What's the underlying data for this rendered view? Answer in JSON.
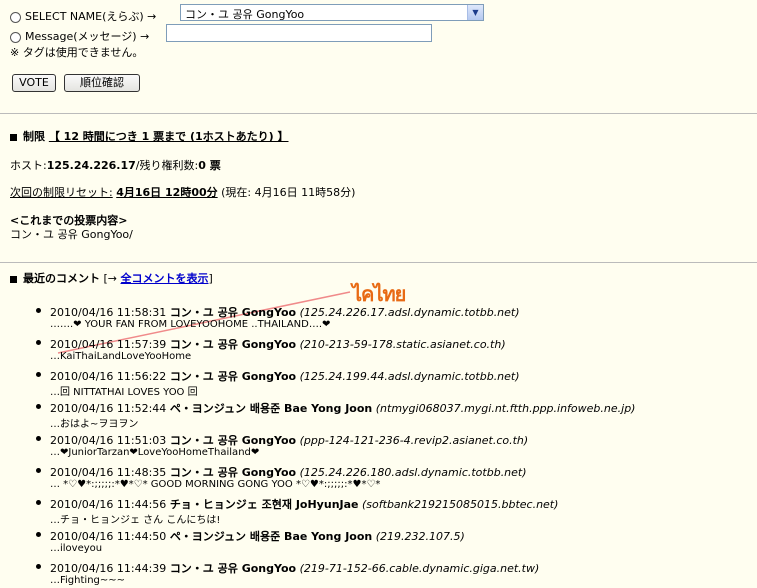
{
  "form": {
    "select_name_label": "SELECT NAME(えらぶ) →",
    "select_value": "コン・ユ 공유 GongYoo",
    "message_label": "Message(メッセージ) →",
    "message_value": "",
    "tag_note": "※ タグは使用できません。",
    "vote_button": "VOTE",
    "rank_button": "順位確認"
  },
  "limits": {
    "heading_prefix": "制限",
    "heading_rule": "【 12 時間につき 1 票まで (1ホストあたり) 】",
    "host_label": "ホスト:",
    "host_value": "125.24.226.17",
    "remaining_label": "/残り権利数:",
    "remaining_value": "0 票",
    "reset_label": "次回の制限リセット:",
    "reset_value": "4月16日 12時00分",
    "current_time": "(現在: 4月16日 11時58分)",
    "history_heading": "<これまでの投票内容>",
    "history_value": "コン・ユ 공유 GongYoo/"
  },
  "comments_section": {
    "heading": "最近のコメント",
    "bracket_open": "[→",
    "show_all_link": "全コメントを表示",
    "bracket_close": "]"
  },
  "comments": [
    {
      "datetime": "2010/04/16 11:58:31",
      "name": "コン・ユ 공유 GongYoo",
      "host": "(125.24.226.17.adsl.dynamic.totbb.net)",
      "message": "…….❤ YOUR FAN FROM LOVEYOOHOME ..THAILAND….❤"
    },
    {
      "datetime": "2010/04/16 11:57:39",
      "name": "コン・ユ 공유 GongYoo",
      "host": "(210-213-59-178.static.asianet.co.th)",
      "message": "…KaiThaiLandLoveYooHome"
    },
    {
      "datetime": "2010/04/16 11:56:22",
      "name": "コン・ユ 공유 GongYoo",
      "host": "(125.24.199.44.adsl.dynamic.totbb.net)",
      "message": "…回 NITTATHAI LOVES YOO 回"
    },
    {
      "datetime": "2010/04/16 11:52:44",
      "name": "ペ・ヨンジュン 배용준 Bae Yong Joon",
      "host": "(ntmygi068037.mygi.nt.ftth.ppp.infoweb.ne.jp)",
      "message": "…おはよ~ヲヨヲン"
    },
    {
      "datetime": "2010/04/16 11:51:03",
      "name": "コン・ユ 공유 GongYoo",
      "host": "(ppp-124-121-236-4.revip2.asianet.co.th)",
      "message": "…❤JuniorTarzan❤LoveYooHomeThailand❤"
    },
    {
      "datetime": "2010/04/16 11:48:35",
      "name": "コン・ユ 공유 GongYoo",
      "host": "(125.24.226.180.adsl.dynamic.totbb.net)",
      "message": "… *♡♥*:;;;;;:*♥*♡* GOOD MORNING GONG YOO *♡♥*:;;;;;:*♥*♡*"
    },
    {
      "datetime": "2010/04/16 11:44:56",
      "name": "チョ・ヒョンジェ 조현재 JoHyunJae",
      "host": "(softbank219215085015.bbtec.net)",
      "message": "…チョ・ヒョンジェ さん こんにちは!"
    },
    {
      "datetime": "2010/04/16 11:44:50",
      "name": "ペ・ヨンジュン 배용준 Bae Yong Joon",
      "host": "(219.232.107.5)",
      "message": "…iloveyou"
    },
    {
      "datetime": "2010/04/16 11:44:39",
      "name": "コン・ユ 공유 GongYoo",
      "host": "(219-71-152-66.cable.dynamic.giga.net.tw)",
      "message": "…Fighting~~~"
    }
  ],
  "annotation_text": "ไคไทย",
  "colors": {
    "background": "#fffef0",
    "link": "#0000cc",
    "annotation": "#e86a14"
  }
}
